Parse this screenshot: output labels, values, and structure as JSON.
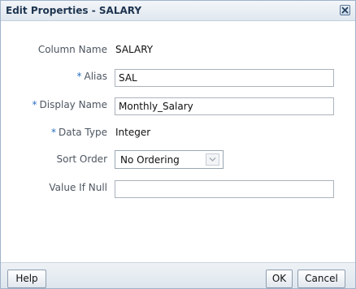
{
  "dialog": {
    "title": "Edit Properties - SALARY",
    "close_icon": "close-x-icon"
  },
  "fields": {
    "column_name": {
      "label": "Column Name",
      "value": "SALARY"
    },
    "alias": {
      "label": "Alias",
      "value": "SAL",
      "required": true
    },
    "display_name": {
      "label": "Display Name",
      "value": "Monthly_Salary",
      "required": true
    },
    "data_type": {
      "label": "Data Type",
      "value": "Integer",
      "required": true
    },
    "sort_order": {
      "label": "Sort Order",
      "selected": "No Ordering"
    },
    "value_if_null": {
      "label": "Value If Null",
      "value": ""
    },
    "required_marker": "*"
  },
  "footer": {
    "help_label": "Help",
    "ok_label": "OK",
    "cancel_label": "Cancel"
  },
  "colors": {
    "title_text": "#1e3550",
    "required_marker": "#2a6ec2",
    "label_text": "#4d5661"
  }
}
